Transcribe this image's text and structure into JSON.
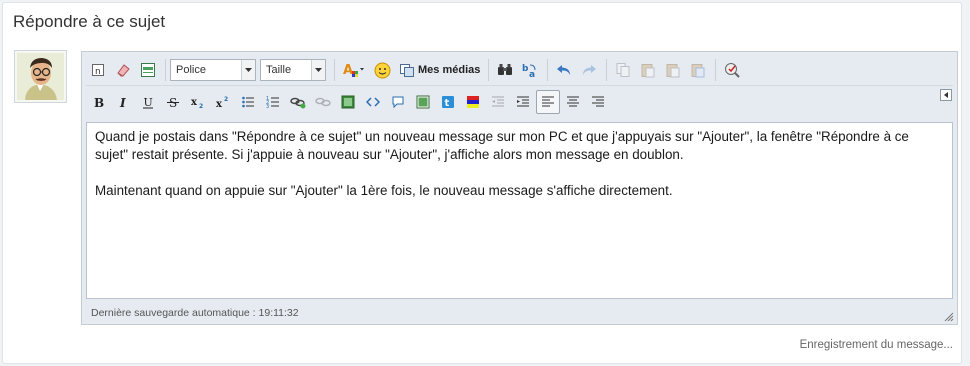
{
  "page": {
    "title": "Répondre à ce sujet",
    "saving_text": "Enregistrement du message..."
  },
  "toolbar": {
    "font_select": "Police",
    "size_select": "Taille",
    "media_label": "Mes médias",
    "row1_icons": [
      "paste-text-icon",
      "eraser-icon",
      "layout-icon",
      "font-color-icon",
      "smiley-icon",
      "media-icon",
      "find-icon",
      "replace-icon",
      "undo-icon",
      "redo-icon",
      "copy-icon",
      "paste-icon",
      "paste-text2-icon",
      "paste-word-icon",
      "spellcheck-icon"
    ],
    "row2_icons": [
      "bold-icon",
      "italic-icon",
      "underline-icon",
      "strikethrough-icon",
      "subscript-icon",
      "superscript-icon",
      "bullet-list-icon",
      "numbered-list-icon",
      "link-icon",
      "unlink-icon",
      "image-icon",
      "code-icon",
      "quote-icon",
      "picture-icon",
      "twitter-icon",
      "color-swatch-icon",
      "outdent-icon",
      "indent-icon",
      "align-left-icon",
      "align-center-icon",
      "align-right-icon"
    ]
  },
  "editor": {
    "paragraphs": [
      "Quand je postais dans \"Répondre à ce sujet\" un nouveau message sur mon PC et que j'appuyais sur \"Ajouter\", la fenêtre \"Répondre à ce sujet\" restait présente. Si j'appuie à nouveau sur \"Ajouter\", j'affiche alors mon message en doublon.",
      "Maintenant quand on appuie sur \"Ajouter\" la 1ère fois, le nouveau message s'affiche directement."
    ],
    "autosave_status": "Dernière sauvegarde automatique : 19:11:32"
  }
}
